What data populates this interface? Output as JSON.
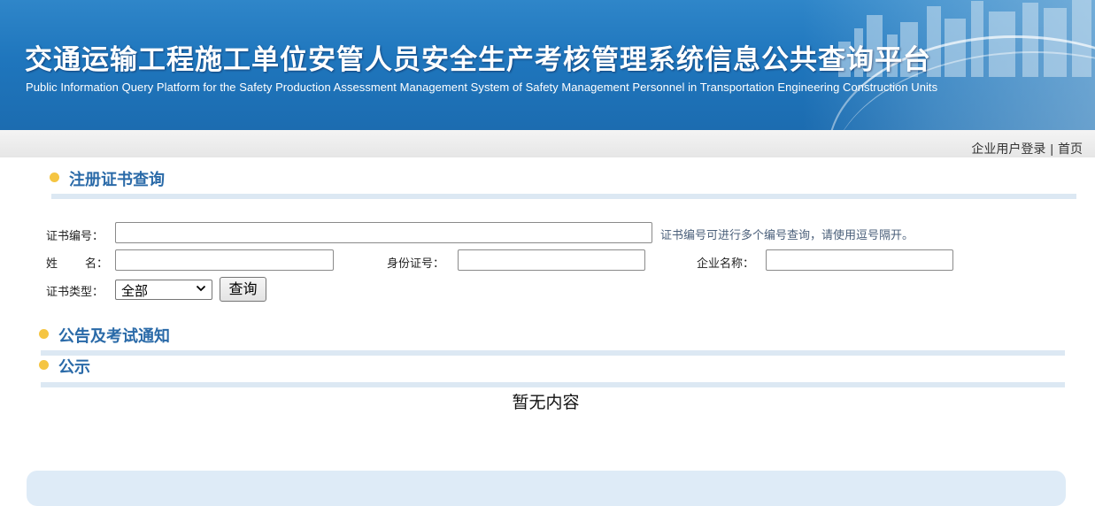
{
  "banner": {
    "title": "交通运输工程施工单位安管人员安全生产考核管理系统信息公共查询平台",
    "subtitle": "Public Information Query Platform for the Safety Production Assessment Management System of Safety Management Personnel in Transportation Engineering Construction Units"
  },
  "nav": {
    "login_label": "企业用户登录",
    "separator": "|",
    "home_label": "首页"
  },
  "cert_query": {
    "section_title": "注册证书查询",
    "cert_no_label": "证书编号：",
    "cert_no_value": "",
    "cert_no_hint": "证书编号可进行多个编号查询，请使用逗号隔开。",
    "name_label_1": "姓",
    "name_label_2": "名：",
    "name_value": "",
    "id_label": "身份证号：",
    "id_value": "",
    "company_label": "企业名称：",
    "company_value": "",
    "cert_type_label": "证书类型：",
    "cert_type_selected": "全部",
    "query_button": "查询"
  },
  "notice_section": {
    "title": "公告及考试通知"
  },
  "public_section": {
    "title": "公示",
    "empty_text": "暂无内容"
  },
  "colors": {
    "banner_blue": "#1f76bd",
    "section_title": "#2a6aa8",
    "section_dot": "#f5c542",
    "section_line": "#dce8f3"
  }
}
